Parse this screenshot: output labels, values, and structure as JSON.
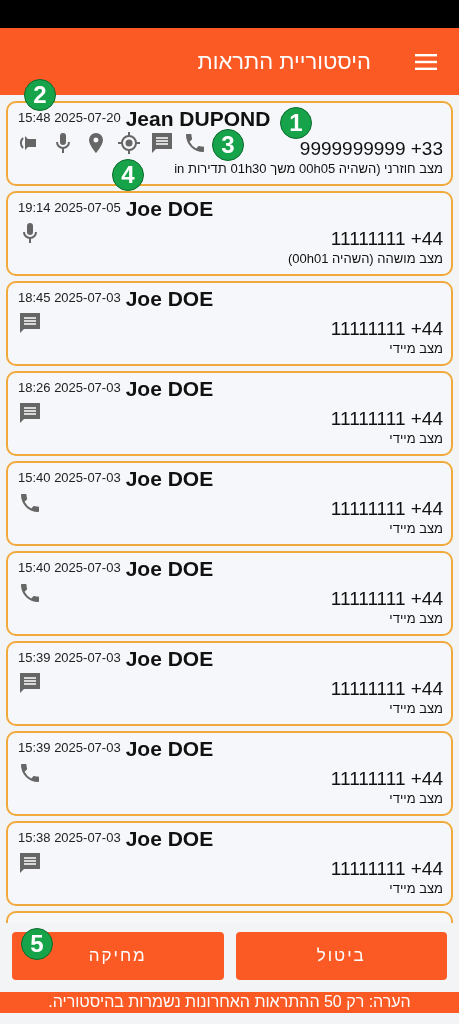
{
  "header": {
    "title": "היסטוריית התראות"
  },
  "alerts": [
    {
      "datetime": "15:48 2025-07-20",
      "name": "Jean DUPOND",
      "phone": "9999999999 +33",
      "status": "מצב חוזרני (השהיה 00h05 משך 01h30 תדירות in",
      "icons": [
        {
          "kind": "speaker"
        },
        {
          "kind": "mic"
        },
        {
          "kind": "pin"
        },
        {
          "kind": "target"
        },
        {
          "kind": "message"
        },
        {
          "kind": "phone"
        }
      ]
    },
    {
      "datetime": "19:14 2025-07-05",
      "name": "Joe DOE",
      "phone": "11111111 +44",
      "status": "מצב מושהה (השהיה 00h01)",
      "icons": [
        {
          "kind": "mic"
        }
      ]
    },
    {
      "datetime": "18:45 2025-07-03",
      "name": "Joe DOE",
      "phone": "11111111 +44",
      "status": "מצב מיידי",
      "icons": [
        {
          "kind": "message"
        }
      ]
    },
    {
      "datetime": "18:26 2025-07-03",
      "name": "Joe DOE",
      "phone": "11111111 +44",
      "status": "מצב מיידי",
      "icons": [
        {
          "kind": "message"
        }
      ]
    },
    {
      "datetime": "15:40 2025-07-03",
      "name": "Joe DOE",
      "phone": "11111111 +44",
      "status": "מצב מיידי",
      "icons": [
        {
          "kind": "phone"
        }
      ]
    },
    {
      "datetime": "15:40 2025-07-03",
      "name": "Joe DOE",
      "phone": "11111111 +44",
      "status": "מצב מיידי",
      "icons": [
        {
          "kind": "phone"
        }
      ]
    },
    {
      "datetime": "15:39 2025-07-03",
      "name": "Joe DOE",
      "phone": "11111111 +44",
      "status": "מצב מיידי",
      "icons": [
        {
          "kind": "message"
        }
      ]
    },
    {
      "datetime": "15:39 2025-07-03",
      "name": "Joe DOE",
      "phone": "11111111 +44",
      "status": "מצב מיידי",
      "icons": [
        {
          "kind": "phone"
        }
      ]
    },
    {
      "datetime": "15:38 2025-07-03",
      "name": "Joe DOE",
      "phone": "11111111 +44",
      "status": "מצב מיידי",
      "icons": [
        {
          "kind": "message"
        }
      ]
    }
  ],
  "buttons": [
    {
      "label": "ביטול"
    },
    {
      "label": "מחיקה"
    }
  ],
  "note": "הערה: רק 50 ההתראות האחרונות נשמרות בהיסטוריה.",
  "callouts": [
    {
      "label": "1"
    },
    {
      "label": "2"
    },
    {
      "label": "3"
    },
    {
      "label": "4"
    },
    {
      "label": "5"
    }
  ]
}
